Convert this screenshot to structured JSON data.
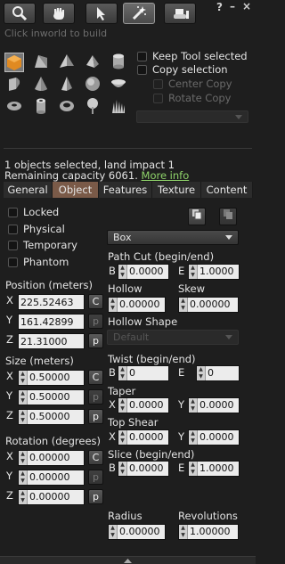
{
  "toolbar": {
    "tools": [
      {
        "icon": "magnifier-icon"
      },
      {
        "icon": "grab-hand-icon"
      },
      {
        "icon": "pointer-arrow-icon"
      },
      {
        "icon": "magic-wand-icon"
      },
      {
        "icon": "bulldozer-icon"
      }
    ],
    "hint": "Click inworld to build",
    "help_label": "?",
    "minimize_label": "–",
    "close_label": "×"
  },
  "create": {
    "shapes": [
      "cube",
      "prism",
      "pyramid",
      "tetrahedron",
      "cylinder",
      "half-cylinder",
      "cone",
      "half-cone",
      "sphere",
      "hemisphere",
      "torus",
      "tube",
      "ring",
      "tree",
      "grass"
    ],
    "keep_tool_selected": "Keep Tool selected",
    "copy_selection": "Copy selection",
    "center_copy": "Center Copy",
    "rotate_copy": "Rotate Copy"
  },
  "selection_info": {
    "line1": "1 objects selected, land impact 1",
    "line2": "Remaining capacity 6061.",
    "more_info": "More info"
  },
  "tabs": [
    "General",
    "Object",
    "Features",
    "Texture",
    "Content"
  ],
  "active_tab": "Object",
  "object": {
    "locked": "Locked",
    "physical": "Physical",
    "temporary": "Temporary",
    "phantom": "Phantom",
    "position_label": "Position (meters)",
    "position": {
      "x": "225.52463",
      "y": "161.42899",
      "z": "21.31000"
    },
    "size_label": "Size (meters)",
    "size": {
      "x": "0.50000",
      "y": "0.50000",
      "z": "0.50000"
    },
    "rotation_label": "Rotation (degrees)",
    "rotation": {
      "x": "0.00000",
      "y": "0.00000",
      "z": "0.00000"
    },
    "copy_btn": "C",
    "paste_btn": "p",
    "prim_type": "Box",
    "path_cut_label": "Path Cut (begin/end)",
    "path_cut": {
      "b": "0.0000",
      "e": "1.0000"
    },
    "hollow_label": "Hollow",
    "hollow": "0.00000",
    "skew_label": "Skew",
    "skew": "0.00000",
    "hollow_shape_label": "Hollow Shape",
    "hollow_shape": "Default",
    "twist_label": "Twist (begin/end)",
    "twist": {
      "b": "0",
      "e": "0"
    },
    "taper_label": "Taper",
    "taper": {
      "x": "0.0000",
      "y": "0.0000"
    },
    "top_shear_label": "Top Shear",
    "top_shear": {
      "x": "0.0000",
      "y": "0.0000"
    },
    "slice_label": "Slice (begin/end)",
    "slice": {
      "b": "0.0000",
      "e": "1.0000"
    },
    "radius_label": "Radius",
    "radius": "0.00000",
    "revolutions_label": "Revolutions",
    "revolutions": "1.00000",
    "axis_labels": {
      "x": "X",
      "y": "Y",
      "z": "Z",
      "b": "B",
      "e": "E"
    }
  }
}
